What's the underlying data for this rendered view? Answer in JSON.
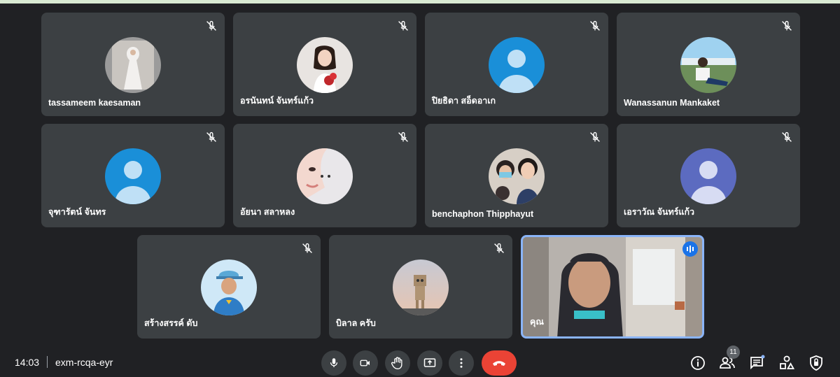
{
  "meeting": {
    "time": "14:03",
    "code": "exm-rcqa-eyr",
    "participant_count": "11"
  },
  "participants": [
    {
      "name": "tassameem kaesaman",
      "muted": true,
      "avatar": "photo-woman-in-white-dress"
    },
    {
      "name": "อรนันทน์ จันทร์แก้ว",
      "muted": true,
      "avatar": "photo-woman-with-red-flowers"
    },
    {
      "name": "ปิยธิดา สอ็ดอาเก",
      "muted": true,
      "avatar": "default-person-icon",
      "avatar_color": "#1a8fd8"
    },
    {
      "name": "Wanassanun Mankaket",
      "muted": true,
      "avatar": "photo-man-sitting-outdoors"
    },
    {
      "name": "จุฑารัตน์ จันทร",
      "muted": true,
      "avatar": "default-person-icon",
      "avatar_color": "#1a8fd8"
    },
    {
      "name": "อัยนา สลาหลง",
      "muted": true,
      "avatar": "photo-close-up-face-white-hijab"
    },
    {
      "name": "benchaphon Thipphayut",
      "muted": true,
      "avatar": "photo-group-selfie"
    },
    {
      "name": "เอราวัณ จันทร์แก้ว",
      "muted": true,
      "avatar": "default-person-icon",
      "avatar_color": "#5c6bc0"
    },
    {
      "name": "สร้างสรรค์ ดับ",
      "muted": true,
      "avatar": "photo-man-in-cap"
    },
    {
      "name": "บิลาล ครับ",
      "muted": true,
      "avatar": "photo-cardboard-robot-figure"
    },
    {
      "name": "คุณ",
      "muted": false,
      "speaking": true,
      "avatar": "video-woman-in-hijab"
    }
  ],
  "colors": {
    "background": "#202124",
    "tile": "#3c4043",
    "hangup": "#ea4335",
    "active_border": "#8ab4f8",
    "accent": "#1a73e8"
  },
  "controls": [
    "mic-icon",
    "camera-icon",
    "raise-hand-icon",
    "present-screen-icon",
    "more-options-icon",
    "hang-up-icon"
  ],
  "right_icons": [
    "info-icon",
    "people-icon",
    "chat-icon",
    "activities-icon",
    "host-controls-icon"
  ]
}
